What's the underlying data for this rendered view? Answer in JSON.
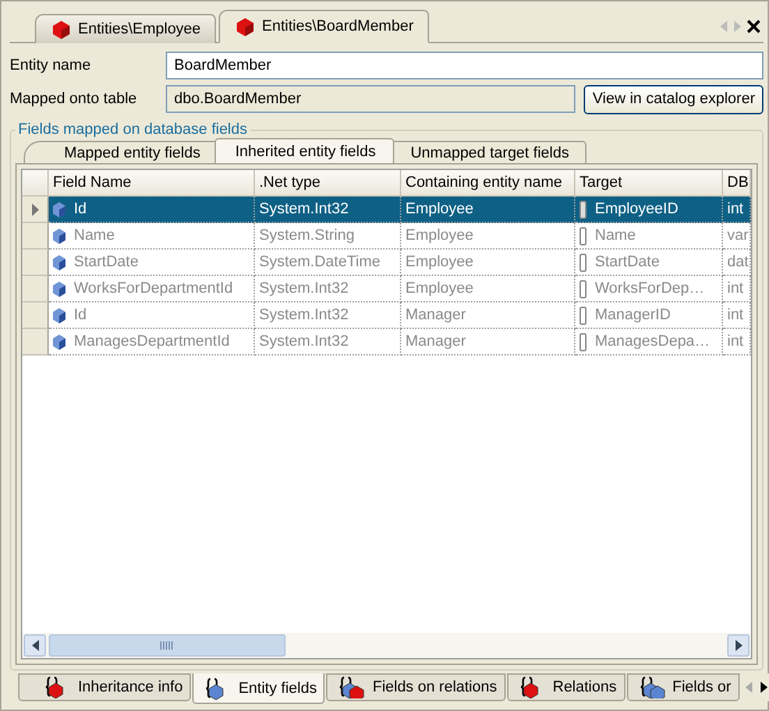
{
  "document_tabs": [
    {
      "label": "Entities\\Employee",
      "selected": false
    },
    {
      "label": "Entities\\BoardMember",
      "selected": true
    }
  ],
  "form": {
    "entity_name": {
      "label": "Entity name",
      "value": "BoardMember"
    },
    "mapped_table": {
      "label": "Mapped onto table",
      "value": "dbo.BoardMember"
    },
    "catalog_button": "View in catalog explorer"
  },
  "group": {
    "title": "Fields mapped on database fields",
    "tabs": [
      {
        "label": "Mapped entity fields",
        "selected": false
      },
      {
        "label": "Inherited entity fields",
        "selected": true
      },
      {
        "label": "Unmapped target fields",
        "selected": false
      }
    ],
    "grid": {
      "columns": [
        "Field Name",
        ".Net type",
        "Containing entity name",
        "Target",
        "DB"
      ],
      "rows": [
        {
          "selected": true,
          "cells": [
            "Id",
            "System.Int32",
            "Employee",
            "EmployeeID",
            "int"
          ]
        },
        {
          "selected": false,
          "cells": [
            "Name",
            "System.String",
            "Employee",
            "Name",
            "var"
          ]
        },
        {
          "selected": false,
          "cells": [
            "StartDate",
            "System.DateTime",
            "Employee",
            "StartDate",
            "dat"
          ]
        },
        {
          "selected": false,
          "cells": [
            "WorksForDepartmentId",
            "System.Int32",
            "Employee",
            "WorksForDep…",
            "int"
          ]
        },
        {
          "selected": false,
          "cells": [
            "Id",
            "System.Int32",
            "Manager",
            "ManagerID",
            "int"
          ]
        },
        {
          "selected": false,
          "cells": [
            "ManagesDepartmentId",
            "System.Int32",
            "Manager",
            "ManagesDepa…",
            "int"
          ]
        }
      ]
    }
  },
  "bottom_tabs": [
    {
      "label": "Inheritance info",
      "selected": false
    },
    {
      "label": "Entity fields",
      "selected": true
    },
    {
      "label": "Fields on relations",
      "selected": false
    },
    {
      "label": "Relations",
      "selected": false
    },
    {
      "label": "Fields or",
      "selected": false
    }
  ]
}
